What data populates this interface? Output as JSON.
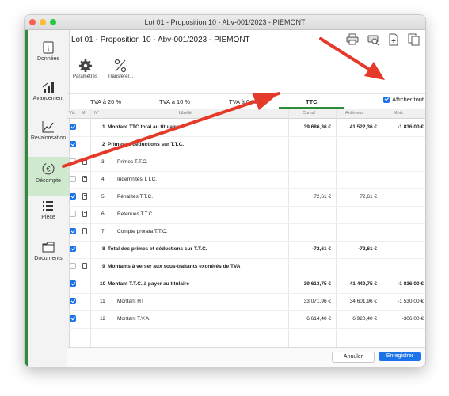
{
  "window": {
    "title": "Lot 01 - Proposition 10 - Abv-001/2023 - PIEMONT"
  },
  "doc_title": "Lot 01 - Proposition 10 - Abv-001/2023 - PIEMONT",
  "sidebar": {
    "items": [
      {
        "label": "Données",
        "icon": "info-icon"
      },
      {
        "label": "Avancement",
        "icon": "bar-chart-icon"
      },
      {
        "label": "Revalorisation",
        "icon": "line-chart-icon"
      },
      {
        "label": "Décompte",
        "icon": "euro-icon",
        "active": true
      },
      {
        "label": "Pièce",
        "icon": "list-icon"
      },
      {
        "label": "Documents",
        "icon": "folder-icon"
      }
    ]
  },
  "toolbar": {
    "params": "Paramètres",
    "transfer": "Transférer..."
  },
  "tabs": [
    "TVA à 20 %",
    "TVA à 10 %",
    "TVA à 0 %",
    "TTC"
  ],
  "active_tab": "TTC",
  "afficher_tout": "Afficher tout",
  "columns": {
    "vis": "Vis.",
    "m": "M.",
    "n": "N°",
    "libelle": "Libellé",
    "cumul": "Cumul",
    "anterieur": "Antérieur",
    "mois": "Mois"
  },
  "rows": [
    {
      "n": "1",
      "label": "Montant TTC total au titulaire",
      "cumul": "39 686,36 €",
      "anterieur": "41 522,36 €",
      "mois": "-1 836,00 €"
    },
    {
      "n": "2",
      "label": "Primes et déductions sur T.T.C.",
      "cumul": "",
      "anterieur": "",
      "mois": ""
    },
    {
      "n": "3",
      "label": "Primes T.T.C.",
      "cumul": "",
      "anterieur": "",
      "mois": ""
    },
    {
      "n": "4",
      "label": "Indemnités T.T.C.",
      "cumul": "",
      "anterieur": "",
      "mois": ""
    },
    {
      "n": "5",
      "label": "Pénalités T.T.C.",
      "cumul": "72,61 €",
      "anterieur": "72,61 €",
      "mois": ""
    },
    {
      "n": "6",
      "label": "Retenues T.T.C.",
      "cumul": "",
      "anterieur": "",
      "mois": ""
    },
    {
      "n": "7",
      "label": "Compte prorata T.T.C.",
      "cumul": "",
      "anterieur": "",
      "mois": ""
    },
    {
      "n": "8",
      "label": "Total des primes et déductions sur T.T.C.",
      "cumul": "-72,61 €",
      "anterieur": "-72,61 €",
      "mois": ""
    },
    {
      "n": "9",
      "label": "Montants à verser aux sous-traitants exonérés de TVA",
      "cumul": "",
      "anterieur": "",
      "mois": ""
    },
    {
      "n": "10",
      "label": "Montant T.T.C. à payer au titulaire",
      "cumul": "39 613,75 €",
      "anterieur": "41 449,75 €",
      "mois": "-1 836,00 €"
    },
    {
      "n": "11",
      "label": "Montant HT",
      "cumul": "33 071,96 €",
      "anterieur": "34 601,96 €",
      "mois": "-1 530,00 €"
    },
    {
      "n": "12",
      "label": "Montant T.V.A.",
      "cumul": "6 614,40 €",
      "anterieur": "6 920,40 €",
      "mois": "-306,00 €"
    }
  ],
  "footer": {
    "cancel": "Annuler",
    "save": "Enregistrer"
  },
  "colors": {
    "accent": "#1a73e8",
    "sidebar_bar": "#2e8b3a",
    "arrow": "#e53a2a"
  }
}
